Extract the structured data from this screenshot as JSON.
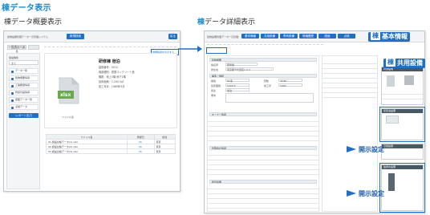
{
  "headings": {
    "title": "棟データ表示",
    "overview": "棟データ概要表示",
    "detail_prefix": "棟",
    "detail_rest": "データ詳細表示"
  },
  "overview_window": {
    "app_title": "建物設備管理データ一元管理システム",
    "search_button": "新規検索",
    "back_button": "戻る",
    "top_button": "一覧表示へ戻る",
    "detail_link": "詳細情報を表示する",
    "sidebar": {
      "field_label": "施設種別",
      "select_value": "全て",
      "items": [
        "データ一覧",
        "建物概要情報",
        "工事履歴情報",
        "修繕計画情報",
        "図面データ一覧",
        "点検データ"
      ],
      "footer_button": "レポート出力"
    },
    "building": {
      "name": "研修棟 宿泊",
      "rows": [
        "建物番号：0012",
        "構造種別：鉄筋コンクリート造",
        "階数：地上3階 地下1階",
        "延床面積：1,200.5㎡",
        "竣工年月：1989年3月"
      ]
    },
    "file_icon_label": "xlsx",
    "file_caption": "ファイル名",
    "table": {
      "headers": [
        "ファイル名",
        "登録日",
        "担当"
      ],
      "rows": [
        [
          "01-施設台帳データ(1).xlsx",
          "DL",
          "東京"
        ],
        [
          "02-施設台帳データ(2).xlsx",
          "DL",
          "東京"
        ],
        [
          "03-施設台帳データ(3).xlsx",
          "DL",
          "東京"
        ]
      ]
    }
  },
  "detail_window": {
    "app_title": "建物設備管理データ一元管理システム",
    "tabs": [
      "基本情報",
      "共用設備",
      "専有設備",
      "修繕履歴",
      "図面",
      "点検"
    ],
    "sections": [
      "建物概要",
      "構造・規模",
      "オーナー情報",
      "管理会社情報",
      "附帯設備"
    ],
    "form_labels": [
      "棟名称",
      "所在地",
      "構造",
      "階数",
      "延床面積",
      "竣工年",
      "用途",
      "備考"
    ],
    "form_values": [
      "研修棟",
      "東京都千代田区1-2-3",
      "RC造",
      "3F/B1",
      "1200.5",
      "1989",
      "宿泊",
      ""
    ],
    "side_cards": [
      "共用設備",
      "受変電設備",
      "空調設備",
      "給排水設備"
    ],
    "badges": {
      "basic_key": "棟",
      "basic": "基本情報",
      "shared_key": "棟",
      "shared": "共用設備"
    },
    "callouts": [
      "開示設定",
      "開示設定"
    ]
  },
  "colors": {
    "accent": "#1b8bd0",
    "button_blue": "#1f6fc6",
    "badge_blue": "#1f6fc6",
    "card_header": "#4a5866"
  }
}
